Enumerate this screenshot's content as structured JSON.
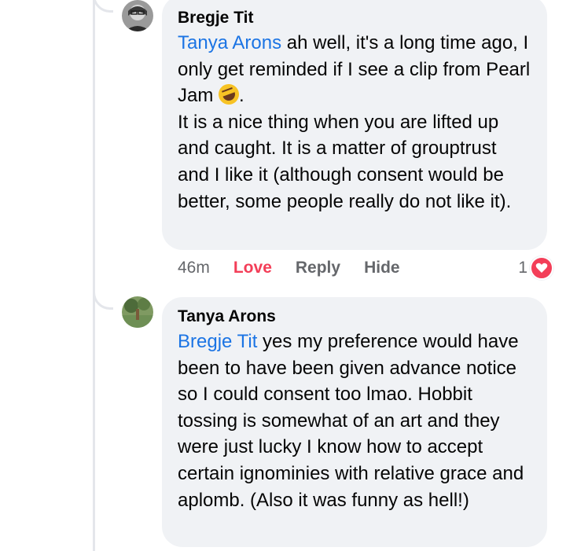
{
  "comments": [
    {
      "author": "Bregje Tit",
      "mention": "Tanya Arons",
      "line1_rest": " ah well, it's a long time ago, I only get reminded if I see a clip from Pearl Jam ",
      "line1_end": ".",
      "paragraph2": "It is a nice thing when you are lifted up and caught. It is a matter of grouptrust and I like it (although consent would be better, some people really do not like it).",
      "emoji": "rolling-on-floor-laughing-icon",
      "time": "46m",
      "love_label": "Love",
      "reply_label": "Reply",
      "hide_label": "Hide",
      "reaction_count": "1"
    },
    {
      "author": "Tanya Arons",
      "mention": "Bregje Tit",
      "text": " yes my preference would have been to have been given advance notice so I could consent too lmao. Hobbit tossing is somewhat of an art and they were just lucky I know how to accept certain ignominies with relative grace and aplomb.  (Also it was funny as hell!)"
    }
  ],
  "colors": {
    "mention": "#1b74e4",
    "love": "#f33e58",
    "bubble": "#f0f2f5",
    "muted": "#65676b"
  }
}
